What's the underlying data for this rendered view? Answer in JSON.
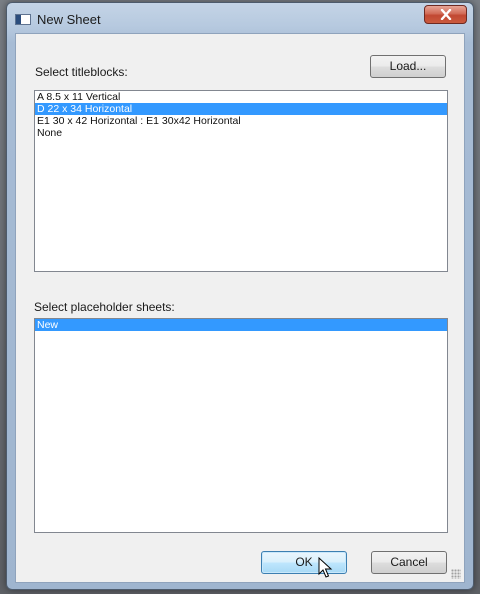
{
  "window": {
    "title": "New Sheet"
  },
  "titleblocks": {
    "label": "Select titleblocks:",
    "load_button": "Load...",
    "items": [
      {
        "text": "A 8.5 x 11 Vertical",
        "selected": false
      },
      {
        "text": "D 22 x 34 Horizontal",
        "selected": true
      },
      {
        "text": "E1 30 x 42 Horizontal : E1 30x42 Horizontal",
        "selected": false
      },
      {
        "text": "None",
        "selected": false
      }
    ]
  },
  "placeholders": {
    "label": "Select placeholder sheets:",
    "items": [
      {
        "text": "New",
        "selected": true
      }
    ]
  },
  "buttons": {
    "ok": "OK",
    "cancel": "Cancel"
  },
  "colors": {
    "selection": "#3399ff",
    "close_button": "#c14832"
  }
}
